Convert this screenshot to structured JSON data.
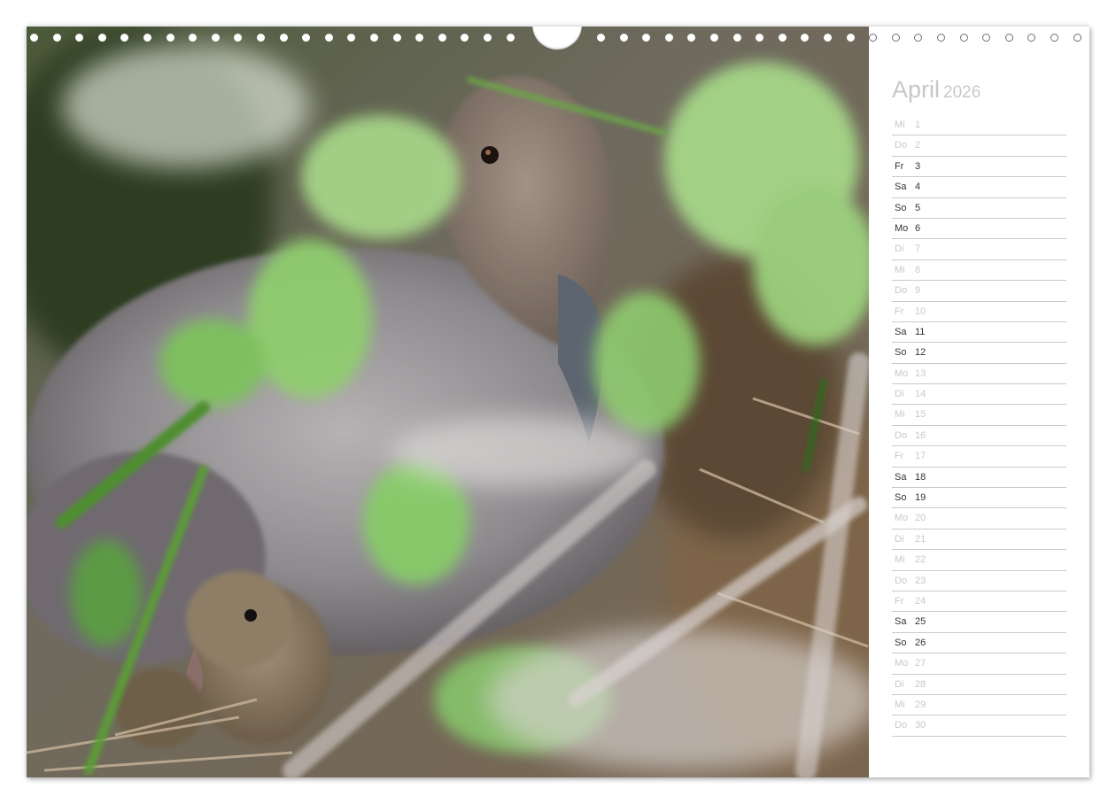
{
  "calendar": {
    "month": "April",
    "year": "2026",
    "days": [
      {
        "wd": "Mi",
        "d": "1",
        "we": false
      },
      {
        "wd": "Do",
        "d": "2",
        "we": false
      },
      {
        "wd": "Fr",
        "d": "3",
        "we": true
      },
      {
        "wd": "Sa",
        "d": "4",
        "we": true
      },
      {
        "wd": "So",
        "d": "5",
        "we": true
      },
      {
        "wd": "Mo",
        "d": "6",
        "we": true
      },
      {
        "wd": "Di",
        "d": "7",
        "we": false
      },
      {
        "wd": "Mi",
        "d": "8",
        "we": false
      },
      {
        "wd": "Do",
        "d": "9",
        "we": false
      },
      {
        "wd": "Fr",
        "d": "10",
        "we": false
      },
      {
        "wd": "Sa",
        "d": "11",
        "we": true
      },
      {
        "wd": "So",
        "d": "12",
        "we": true
      },
      {
        "wd": "Mo",
        "d": "13",
        "we": false
      },
      {
        "wd": "Di",
        "d": "14",
        "we": false
      },
      {
        "wd": "Mi",
        "d": "15",
        "we": false
      },
      {
        "wd": "Do",
        "d": "16",
        "we": false
      },
      {
        "wd": "Fr",
        "d": "17",
        "we": false
      },
      {
        "wd": "Sa",
        "d": "18",
        "we": true
      },
      {
        "wd": "So",
        "d": "19",
        "we": true
      },
      {
        "wd": "Mo",
        "d": "20",
        "we": false
      },
      {
        "wd": "Di",
        "d": "21",
        "we": false
      },
      {
        "wd": "Mi",
        "d": "22",
        "we": false
      },
      {
        "wd": "Do",
        "d": "23",
        "we": false
      },
      {
        "wd": "Fr",
        "d": "24",
        "we": false
      },
      {
        "wd": "Sa",
        "d": "25",
        "we": true
      },
      {
        "wd": "So",
        "d": "26",
        "we": true
      },
      {
        "wd": "Mo",
        "d": "27",
        "we": false
      },
      {
        "wd": "Di",
        "d": "28",
        "we": false
      },
      {
        "wd": "Mi",
        "d": "29",
        "we": false
      },
      {
        "wd": "Do",
        "d": "30",
        "we": false
      }
    ]
  },
  "colors": {
    "weekday_text": "#c8c8c8",
    "weekend_text": "#333333",
    "rule_line": "#c9c9c9",
    "title_text": "#c7c7c7"
  },
  "photo": {
    "subject": "duck-with-duckling-photo"
  }
}
